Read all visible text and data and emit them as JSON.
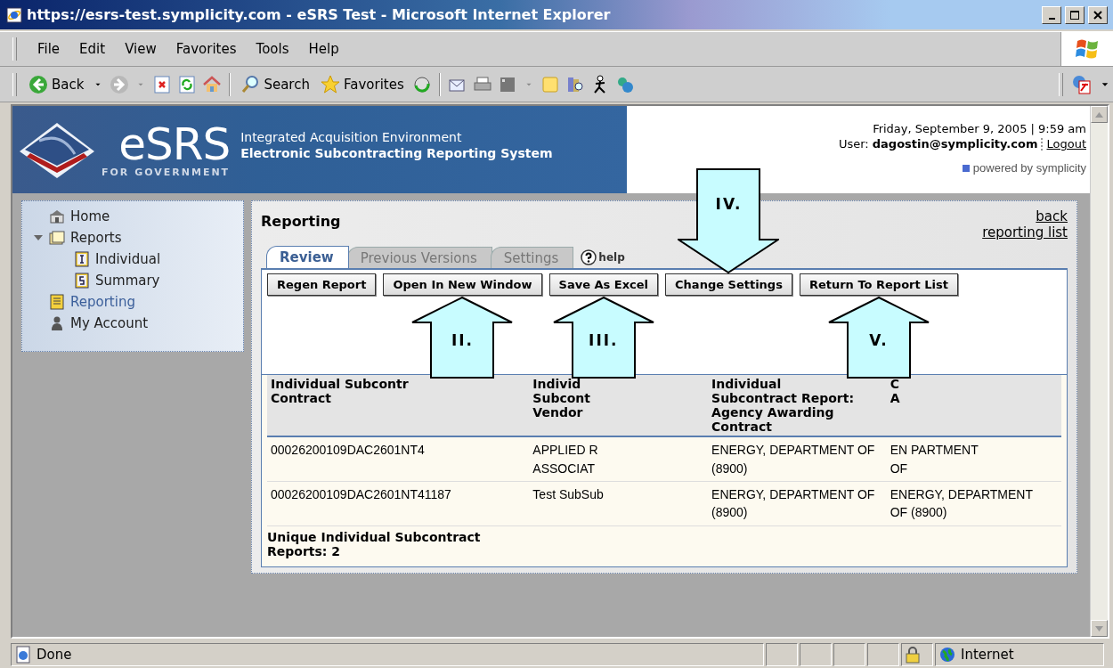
{
  "window": {
    "title": "https://esrs-test.symplicity.com - eSRS Test - Microsoft Internet Explorer"
  },
  "menu": [
    "File",
    "Edit",
    "View",
    "Favorites",
    "Tools",
    "Help"
  ],
  "toolbar": {
    "back": "Back",
    "search": "Search",
    "favorites": "Favorites"
  },
  "banner": {
    "logo": "eSRS",
    "logo_sub": "FOR GOVERNMENT",
    "line1": "Integrated Acquisition Environment",
    "line2": "Electronic Subcontracting Reporting System",
    "date": "Friday, September 9, 2005 | 9:59 am",
    "user_label": "User:",
    "user": "dagostin@symplicity.com",
    "logout": "Logout",
    "powered": "powered by symplicity"
  },
  "sidebar": {
    "items": [
      {
        "label": "Home",
        "kind": "home",
        "selected": false
      },
      {
        "label": "Reports",
        "kind": "folder",
        "selected": false,
        "expanded": true,
        "children": [
          {
            "label": "Individual",
            "kind": "individual",
            "selected": false
          },
          {
            "label": "Summary",
            "kind": "summary",
            "selected": false
          }
        ]
      },
      {
        "label": "Reporting",
        "kind": "reporting",
        "selected": true
      },
      {
        "label": "My Account",
        "kind": "account",
        "selected": false
      }
    ]
  },
  "panel": {
    "title": "Reporting",
    "links": [
      "back",
      "reporting list"
    ],
    "tabs": [
      {
        "label": "Review",
        "selected": true
      },
      {
        "label": "Previous Versions",
        "selected": false
      },
      {
        "label": "Settings",
        "selected": false
      }
    ],
    "help": "help",
    "buttons": [
      {
        "label": "Regen Report"
      },
      {
        "label": "Open In New Window",
        "callout": {
          "label": "II.",
          "kind": "up-arrow"
        }
      },
      {
        "label": "Save As Excel",
        "callout": {
          "label": "III.",
          "kind": "up-arrow"
        }
      },
      {
        "label": "Change Settings",
        "callout": {
          "label": "IV.",
          "kind": "down-arrow"
        }
      },
      {
        "label": "Return To Report List",
        "callout": {
          "label": "V.",
          "kind": "up-arrow"
        }
      }
    ],
    "table": {
      "columns": [
        "Individual Subcontr\nContract",
        "Individ\nSubcont\nVendor",
        "Individual\nSubcontract Report:\nAgency Awarding\nContract",
        "C\nA"
      ],
      "rows": [
        [
          "00026200109DAC2601NT4",
          "APPLIED R\nASSOCIAT",
          "ENERGY, DEPARTMENT OF\n(8900)",
          "EN PARTMENT\nOF"
        ],
        [
          "00026200109DAC2601NT41187",
          "Test SubSub",
          "ENERGY, DEPARTMENT OF\n(8900)",
          "ENERGY, DEPARTMENT\nOF (8900)"
        ]
      ],
      "footer": "Unique Individual Subcontract Reports: 2"
    }
  },
  "status_bar": {
    "text": "Done",
    "zone": "Internet"
  }
}
